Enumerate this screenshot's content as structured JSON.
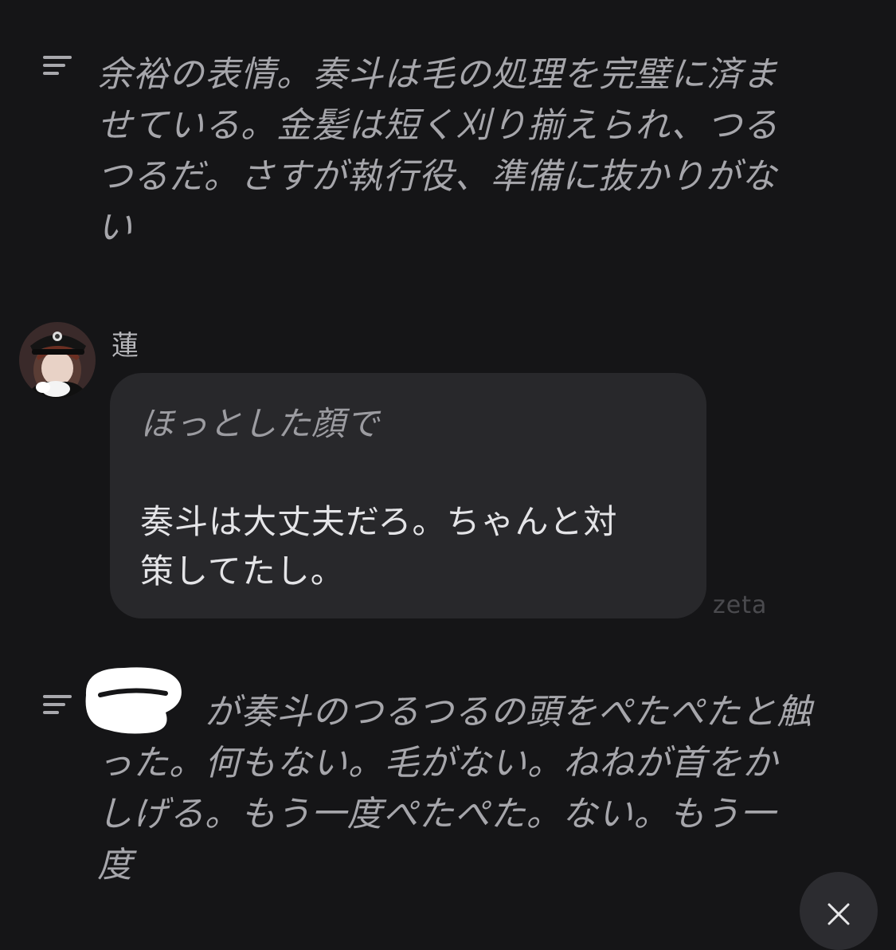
{
  "chat": {
    "narration_1": {
      "icon": "narration-lines-icon",
      "text": "余裕の表情。奏斗は毛の処理を完璧に済ま\nせている。金髪は短く刈り揃えられ、つる\nつるだ。さすが執行役、準備に抜かりがな\nい"
    },
    "message": {
      "avatar": "character-avatar",
      "name": "蓮",
      "action": "ほっとした顔で",
      "speech": "奏斗は大丈夫だろ。ちゃんと対\n策してたし。",
      "watermark": "zeta"
    },
    "narration_2": {
      "icon": "narration-lines-icon",
      "text": "　　　が奏斗のつるつるの頭をぺたぺたと触\nった。何もない。毛がない。ねねが首をか\nしげる。もう一度ぺたぺた。ない。もう一\n度"
    },
    "scroll_button": {
      "icon": "chevron-down-icon"
    }
  },
  "colors": {
    "background": "#151517",
    "bubble": "#28282b",
    "narration_text": "#a6a6ab",
    "speech_text": "#e4e4e7"
  }
}
